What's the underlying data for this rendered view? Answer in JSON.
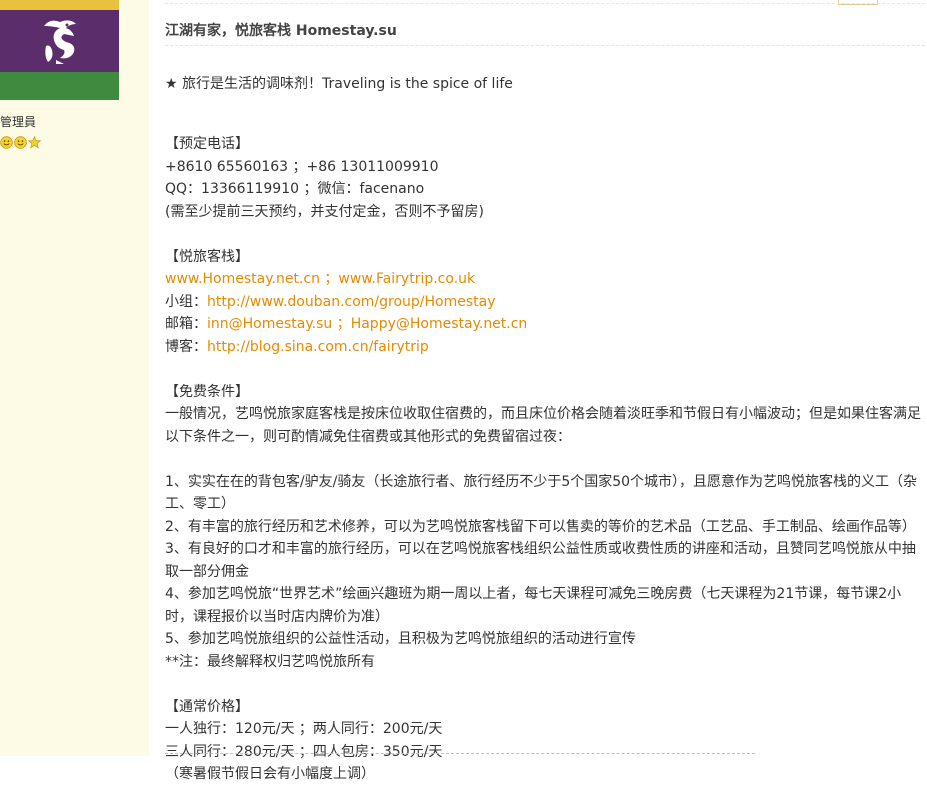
{
  "sidebar": {
    "role": "管理員",
    "rank_icons": [
      "smiley-icon",
      "smiley-icon",
      "star-icon"
    ],
    "colors": {
      "background": "#fdfbe6",
      "avatar_top": "#e8c23e",
      "avatar_purple": "#5b2d6b",
      "avatar_green": "#3e8a3e"
    }
  },
  "post": {
    "title": "江湖有家，悦旅客栈 Homestay.su",
    "slogan": "★ 旅行是生活的调味剂！Traveling is the spice of life",
    "booking": {
      "header": "【预定电话】",
      "phone": "+8610 65560163 ；+86 13011009910",
      "qq_wechat": "QQ：13366119910 ；微信：facenano",
      "note": "(需至少提前三天预约，并支付定金，否则不予留房)"
    },
    "inn": {
      "header": "【悦旅客栈】",
      "site1": "www.Homestay.net.cn",
      "sep1": " ；",
      "site2": "www.Fairytrip.co.uk",
      "group_label": "小组：",
      "group_url": "http://www.douban.com/group/Homestay",
      "mail_label": "邮箱：",
      "mail1": "inn@Homestay.su",
      "sep2": " ；",
      "mail2": "Happy@Homestay.net.cn",
      "blog_label": "博客：",
      "blog_url": "http://blog.sina.com.cn/fairytrip"
    },
    "free": {
      "header": "【免费条件】",
      "intro": "一般情况，艺鸣悦旅家庭客栈是按床位收取住宿费的，而且床位价格会随着淡旺季和节假日有小幅波动；但是如果住客满足以下条件之一，则可酌情减免住宿费或其他形式的免费留宿过夜：",
      "items": [
        "1、实实在在的背包客/驴友/骑友（长途旅行者、旅行经历不少于5个国家50个城市），且愿意作为艺鸣悦旅客栈的义工（杂工、零工）",
        "2、有丰富的旅行经历和艺术修养，可以为艺鸣悦旅客栈留下可以售卖的等价的艺术品（工艺品、手工制品、绘画作品等）",
        "3、有良好的口才和丰富的旅行经历，可以在艺鸣悦旅客栈组织公益性质或收费性质的讲座和活动，且赞同艺鸣悦旅从中抽取一部分佣金",
        "4、参加艺鸣悦旅“世界艺术”绘画兴趣班为期一周以上者，每七天课程可减免三晚房费（七天课程为21节课，每节课2小时，课程报价以当时店内牌价为准）",
        "5、参加艺鸣悦旅组织的公益性活动，且积极为艺鸣悦旅组织的活动进行宣传"
      ],
      "footnote": "**注：最终解释权归艺鸣悦旅所有"
    },
    "price": {
      "header": "【通常价格】",
      "line1": "一人独行：120元/天 ；两人同行：200元/天",
      "line2": "三人同行：280元/天 ；四人包房：350元/天",
      "note": "（寒暑假节假日会有小幅度上调）"
    },
    "colors": {
      "text": "#333333",
      "link": "#e68a00"
    }
  }
}
